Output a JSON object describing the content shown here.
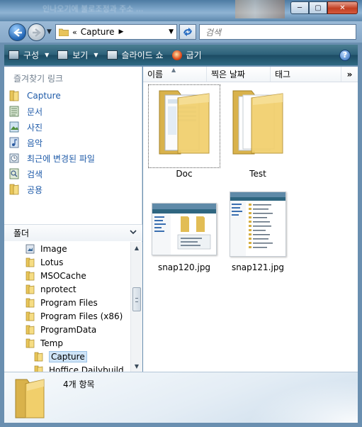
{
  "window": {
    "title_blur": "인나오기에 불로조정과 주소 ...",
    "buttons": {
      "minimize": "─",
      "maximize": "▢",
      "close": "✕"
    }
  },
  "address": {
    "chevron": "«",
    "path": "Capture",
    "separator": "▶",
    "dropdown": "▼",
    "refresh_icon": "refresh-icon",
    "search_placeholder": "검색"
  },
  "toolbar": {
    "organize": "구성",
    "view": "보기",
    "slideshow": "슬라이드 쇼",
    "burn": "굽기",
    "help": "?"
  },
  "favorites": {
    "title": "즐겨찾기 링크",
    "items": [
      {
        "label": "Capture",
        "icon": "folder-icon"
      },
      {
        "label": "문서",
        "icon": "documents-icon"
      },
      {
        "label": "사진",
        "icon": "pictures-icon"
      },
      {
        "label": "음악",
        "icon": "music-icon"
      },
      {
        "label": "최근에 변경된 파일",
        "icon": "recent-icon"
      },
      {
        "label": "검색",
        "icon": "search-icon"
      },
      {
        "label": "공용",
        "icon": "folder-icon"
      }
    ]
  },
  "folders": {
    "header": "폴더",
    "items": [
      {
        "label": "Image",
        "indent": 0,
        "icon": "image-folder-icon"
      },
      {
        "label": "Lotus",
        "indent": 0
      },
      {
        "label": "MSOCache",
        "indent": 0
      },
      {
        "label": "nprotect",
        "indent": 0
      },
      {
        "label": "Program Files",
        "indent": 0
      },
      {
        "label": "Program Files (x86)",
        "indent": 0
      },
      {
        "label": "ProgramData",
        "indent": 0
      },
      {
        "label": "Temp",
        "indent": 0
      },
      {
        "label": "Capture",
        "indent": 1,
        "selected": true
      },
      {
        "label": "Hoffice Dailybuild",
        "indent": 1
      }
    ]
  },
  "columns": {
    "name": "이름",
    "date": "찍은 날짜",
    "tag": "태그",
    "more": "»"
  },
  "files": [
    {
      "label": "Doc",
      "type": "folder"
    },
    {
      "label": "Test",
      "type": "folder"
    },
    {
      "label": "snap120.jpg",
      "type": "image"
    },
    {
      "label": "snap121.jpg",
      "type": "image"
    }
  ],
  "status": {
    "count": "4개 항목"
  }
}
